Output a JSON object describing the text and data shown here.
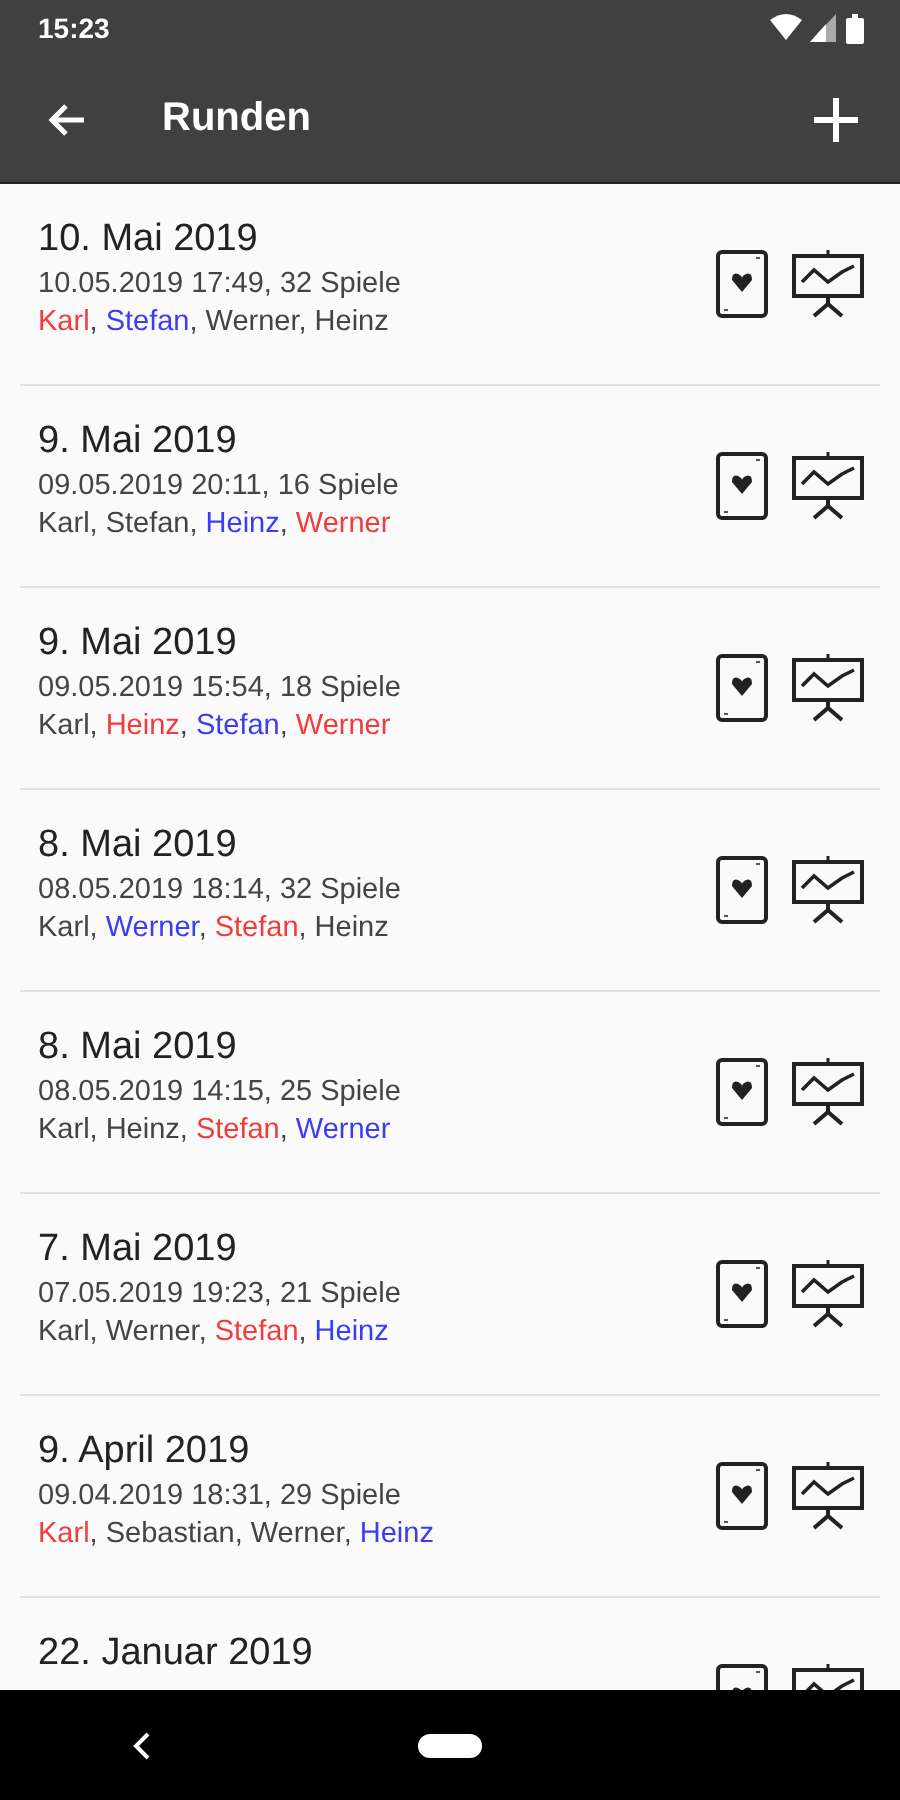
{
  "status_bar": {
    "time": "15:23"
  },
  "app_bar": {
    "title": "Runden"
  },
  "rounds": [
    {
      "title": "10. Mai 2019",
      "details": "10.05.2019 17:49, 32 Spiele",
      "players": [
        {
          "name": "Karl",
          "sep": ",",
          "color": "#f03c3c"
        },
        {
          "name": "Stefan",
          "sep": ",",
          "color": "#3c3cf0"
        },
        {
          "name": "Werner",
          "sep": ",",
          "color": "#444444"
        },
        {
          "name": "Heinz",
          "color": "#444444"
        }
      ]
    },
    {
      "title": "9. Mai 2019",
      "details": "09.05.2019 20:11, 16 Spiele",
      "players": [
        {
          "name": "Karl",
          "sep": ",",
          "color": "#444444"
        },
        {
          "name": "Stefan",
          "sep": ",",
          "color": "#444444"
        },
        {
          "name": "Heinz",
          "sep": ",",
          "color": "#3c3cf0"
        },
        {
          "name": "Werner",
          "color": "#f03c3c"
        }
      ]
    },
    {
      "title": "9. Mai 2019",
      "details": "09.05.2019 15:54, 18 Spiele",
      "players": [
        {
          "name": "Karl",
          "sep": ",",
          "color": "#444444"
        },
        {
          "name": "Heinz",
          "sep": ",",
          "color": "#f03c3c"
        },
        {
          "name": "Stefan",
          "sep": ",",
          "color": "#3c3cf0"
        },
        {
          "name": "Werner",
          "color": "#f03c3c"
        }
      ]
    },
    {
      "title": "8. Mai 2019",
      "details": "08.05.2019 18:14, 32 Spiele",
      "players": [
        {
          "name": "Karl",
          "sep": ",",
          "color": "#444444"
        },
        {
          "name": "Werner",
          "sep": ",",
          "color": "#3c3cf0"
        },
        {
          "name": "Stefan",
          "sep": ",",
          "color": "#f03c3c"
        },
        {
          "name": "Heinz",
          "color": "#444444"
        }
      ]
    },
    {
      "title": "8. Mai 2019",
      "details": "08.05.2019 14:15, 25 Spiele",
      "players": [
        {
          "name": "Karl",
          "sep": ",",
          "color": "#444444"
        },
        {
          "name": "Heinz",
          "sep": ",",
          "color": "#444444"
        },
        {
          "name": "Stefan",
          "sep": ",",
          "color": "#f03c3c"
        },
        {
          "name": "Werner",
          "color": "#3c3cf0"
        }
      ]
    },
    {
      "title": "7. Mai 2019",
      "details": "07.05.2019 19:23, 21 Spiele",
      "players": [
        {
          "name": "Karl",
          "sep": ",",
          "color": "#444444"
        },
        {
          "name": "Werner",
          "sep": ",",
          "color": "#444444"
        },
        {
          "name": "Stefan",
          "sep": ",",
          "color": "#f03c3c"
        },
        {
          "name": "Heinz",
          "color": "#3c3cf0"
        }
      ]
    },
    {
      "title": "9. April 2019",
      "details": "09.04.2019 18:31, 29 Spiele",
      "players": [
        {
          "name": "Karl",
          "sep": ",",
          "color": "#f03c3c"
        },
        {
          "name": "Sebastian",
          "sep": ",",
          "color": "#444444"
        },
        {
          "name": "Werner",
          "sep": ",",
          "color": "#444444"
        },
        {
          "name": "Heinz",
          "color": "#3c3cf0"
        }
      ]
    },
    {
      "title": "22. Januar 2019"
    }
  ]
}
